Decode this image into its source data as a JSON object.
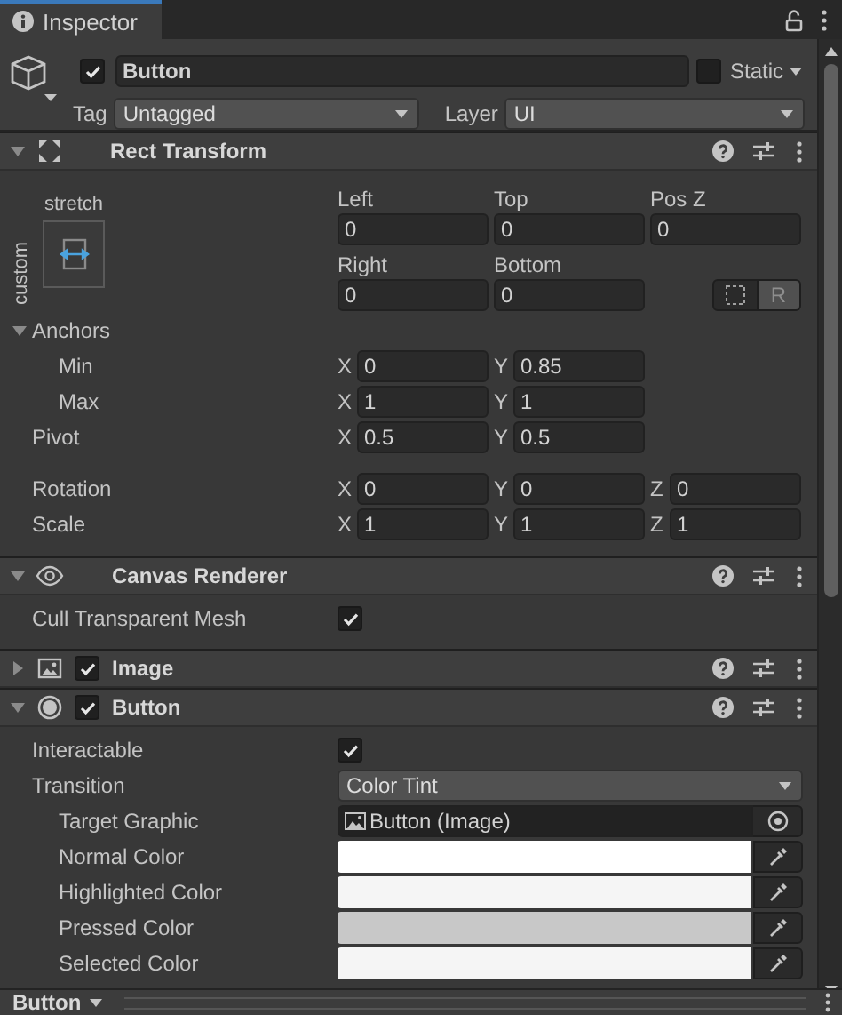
{
  "tab": {
    "title": "Inspector"
  },
  "object": {
    "active": true,
    "name": "Button",
    "static": false,
    "static_label": "Static",
    "tag_label": "Tag",
    "tag": "Untagged",
    "layer_label": "Layer",
    "layer": "UI"
  },
  "components": [
    {
      "kind": "rect_transform",
      "title": "Rect Transform",
      "expanded": true,
      "preset": {
        "horizontal": "stretch",
        "vertical": "custom"
      },
      "offsets": [
        [
          {
            "label": "Left",
            "value": "0"
          },
          {
            "label": "Top",
            "value": "0"
          },
          {
            "label": "Pos Z",
            "value": "0"
          }
        ],
        [
          {
            "label": "Right",
            "value": "0"
          },
          {
            "label": "Bottom",
            "value": "0"
          }
        ]
      ],
      "raw_edit_button": "R",
      "anchors": {
        "label": "Anchors",
        "expanded": true,
        "children": [
          {
            "label": "Min",
            "values": [
              {
                "axis": "X",
                "value": "0"
              },
              {
                "axis": "Y",
                "value": "0.85"
              }
            ]
          },
          {
            "label": "Max",
            "values": [
              {
                "axis": "X",
                "value": "1"
              },
              {
                "axis": "Y",
                "value": "1"
              }
            ]
          }
        ]
      },
      "vectors": [
        {
          "label": "Pivot",
          "values": [
            {
              "axis": "X",
              "value": "0.5"
            },
            {
              "axis": "Y",
              "value": "0.5"
            }
          ]
        },
        {
          "label": "Rotation",
          "values": [
            {
              "axis": "X",
              "value": "0"
            },
            {
              "axis": "Y",
              "value": "0"
            },
            {
              "axis": "Z",
              "value": "0"
            }
          ]
        },
        {
          "label": "Scale",
          "values": [
            {
              "axis": "X",
              "value": "1"
            },
            {
              "axis": "Y",
              "value": "1"
            },
            {
              "axis": "Z",
              "value": "1"
            }
          ]
        }
      ]
    },
    {
      "kind": "canvas_renderer",
      "title": "Canvas Renderer",
      "expanded": true,
      "properties": [
        {
          "kind": "checkbox",
          "label": "Cull Transparent Mesh",
          "checked": true
        }
      ]
    },
    {
      "kind": "image",
      "title": "Image",
      "expanded": false,
      "enabled": true
    },
    {
      "kind": "button",
      "title": "Button",
      "expanded": true,
      "enabled": true,
      "properties": [
        {
          "kind": "checkbox",
          "label": "Interactable",
          "checked": true
        },
        {
          "kind": "dropdown",
          "label": "Transition",
          "value": "Color Tint",
          "children": [
            {
              "kind": "object",
              "label": "Target Graphic",
              "value": "Button (Image)"
            },
            {
              "kind": "color",
              "label": "Normal Color",
              "color": "#ffffff"
            },
            {
              "kind": "color",
              "label": "Highlighted Color",
              "color": "#f5f5f5"
            },
            {
              "kind": "color",
              "label": "Pressed Color",
              "color": "#c8c8c8"
            },
            {
              "kind": "color",
              "label": "Selected Color",
              "color": "#f5f5f5"
            }
          ]
        }
      ]
    }
  ],
  "preview": {
    "title": "Button"
  }
}
